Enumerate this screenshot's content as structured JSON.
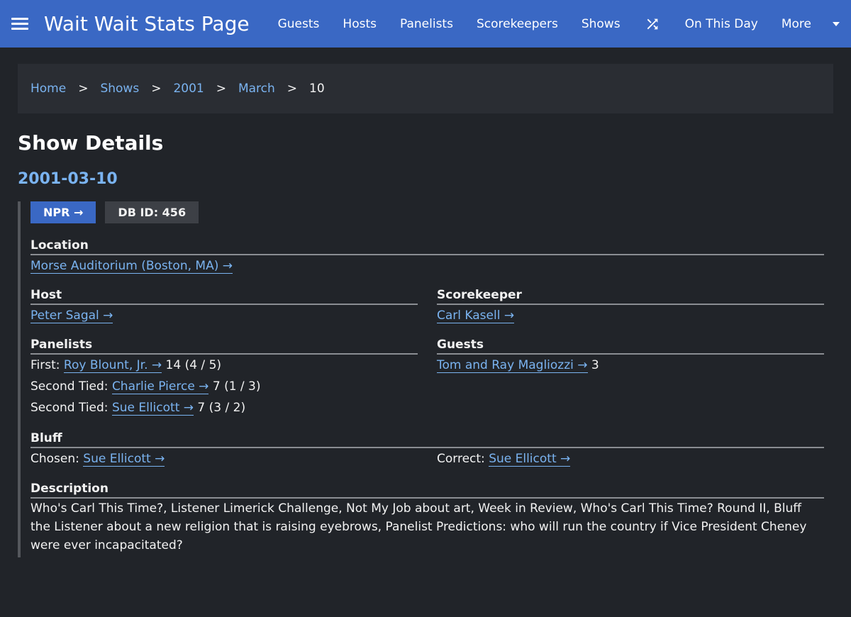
{
  "header": {
    "title": "Wait Wait Stats Page",
    "nav": [
      "Guests",
      "Hosts",
      "Panelists",
      "Scorekeepers",
      "Shows"
    ],
    "random_icon": "shuffle-icon",
    "on_this_day": "On This Day",
    "more": "More"
  },
  "breadcrumb": {
    "items": [
      "Home",
      "Shows",
      "2001",
      "March"
    ],
    "current": "10",
    "separator": ">"
  },
  "page": {
    "title": "Show Details",
    "date": "2001-03-10"
  },
  "badges": {
    "npr": "NPR →",
    "db_id": "DB ID: 456"
  },
  "location": {
    "label": "Location",
    "value": "Morse Auditorium (Boston, MA) →"
  },
  "host": {
    "label": "Host",
    "value": "Peter Sagal →"
  },
  "scorekeeper": {
    "label": "Scorekeeper",
    "value": "Carl Kasell →"
  },
  "panelists": {
    "label": "Panelists",
    "rows": [
      {
        "place": "First:",
        "name": "Roy Blount, Jr. →",
        "score": "14 (4 / 5)"
      },
      {
        "place": "Second Tied:",
        "name": "Charlie Pierce →",
        "score": "7 (1 / 3)"
      },
      {
        "place": "Second Tied:",
        "name": "Sue Ellicott →",
        "score": "7 (3 / 2)"
      }
    ]
  },
  "guests": {
    "label": "Guests",
    "rows": [
      {
        "name": "Tom and Ray Magliozzi →",
        "score": "3"
      }
    ]
  },
  "bluff": {
    "label": "Bluff",
    "chosen_label": "Chosen:",
    "chosen": "Sue Ellicott →",
    "correct_label": "Correct:",
    "correct": "Sue Ellicott →"
  },
  "description": {
    "label": "Description",
    "text": "Who's Carl This Time?, Listener Limerick Challenge, Not My Job about art, Week in Review, Who's Carl This Time? Round II, Bluff the Listener about a new religion that is raising eyebrows, Panelist Predictions: who will run the country if Vice President Cheney were ever incapacitated?"
  },
  "colors": {
    "header_bg": "#3a68c4",
    "page_bg": "#212429",
    "link": "#7ab3f0"
  }
}
